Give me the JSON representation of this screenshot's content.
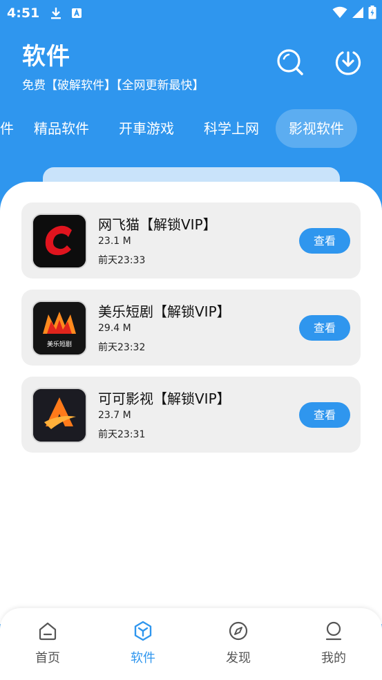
{
  "status_bar": {
    "time": "4:51"
  },
  "header": {
    "title": "软件",
    "subtitle": "免费【破解软件】【全网更新最快】"
  },
  "tabs": [
    {
      "label": "件",
      "active": false
    },
    {
      "label": "精品软件",
      "active": false
    },
    {
      "label": "开車游戏",
      "active": false
    },
    {
      "label": "科学上网",
      "active": false
    },
    {
      "label": "影视软件",
      "active": true
    }
  ],
  "apps": [
    {
      "name": "网飞猫【解锁VIP】",
      "size": "23.1 M",
      "time": "前天23:33",
      "button": "查看",
      "icon": "netcat-logo-icon"
    },
    {
      "name": "美乐短剧【解锁VIP】",
      "size": "29.4 M",
      "time": "前天23:32",
      "button": "查看",
      "icon": "meile-logo-icon",
      "icon_text": "美乐短剧"
    },
    {
      "name": "可可影视【解锁VIP】",
      "size": "23.7 M",
      "time": "前天23:31",
      "button": "查看",
      "icon": "keke-logo-icon"
    }
  ],
  "bottom_nav": [
    {
      "label": "首页",
      "icon": "home-icon",
      "active": false
    },
    {
      "label": "软件",
      "icon": "cube-icon",
      "active": true
    },
    {
      "label": "发现",
      "icon": "compass-icon",
      "active": false
    },
    {
      "label": "我的",
      "icon": "user-icon",
      "active": false
    }
  ],
  "colors": {
    "primary": "#2f96ee",
    "card_bg": "#efefef",
    "sheet_bg": "#ffffff"
  }
}
